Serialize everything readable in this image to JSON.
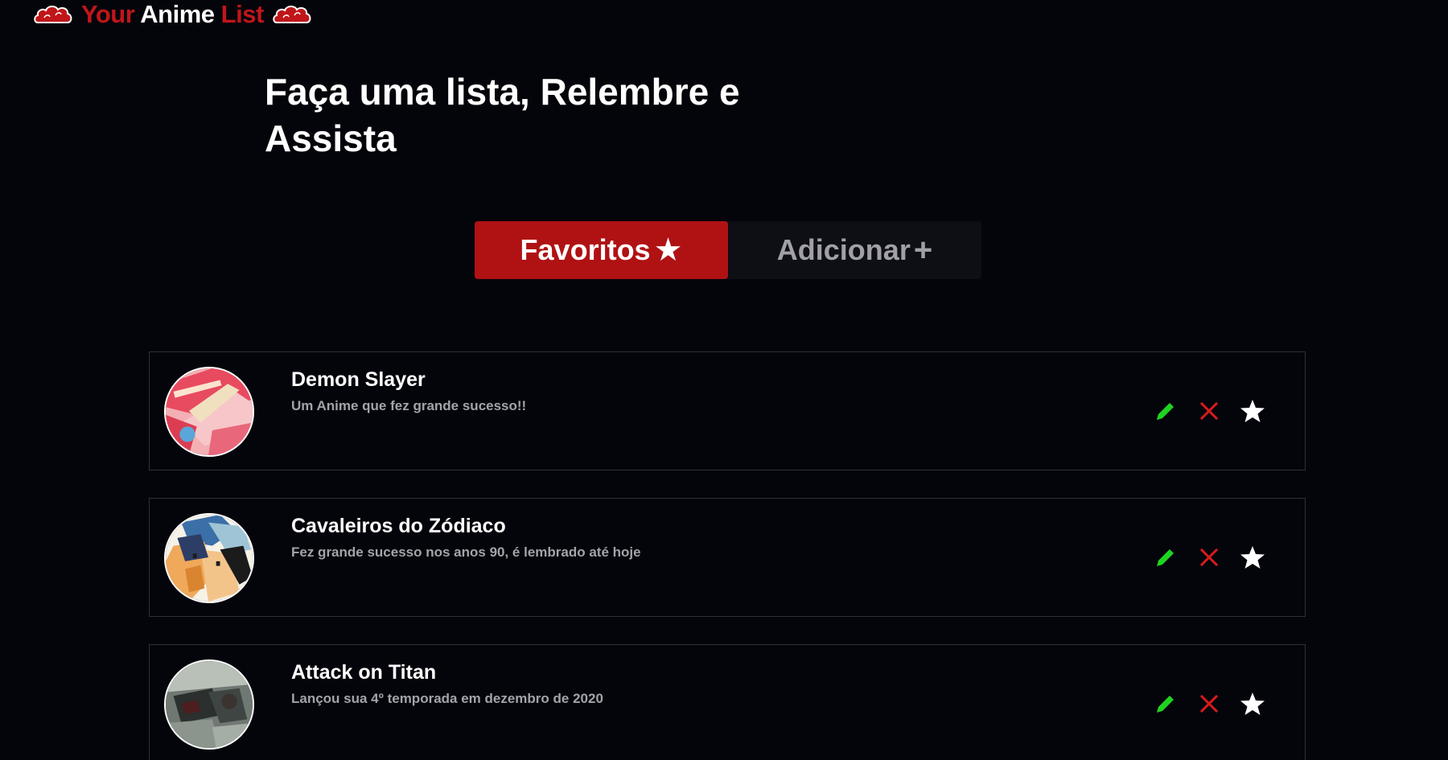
{
  "logo": {
    "part1": "Your",
    "part2": "Anime",
    "part3": "List",
    "icon": "akatsuki-cloud-icon",
    "accent": "#c0161a"
  },
  "hero": {
    "title": "Faça uma lista, Relembre e Assista"
  },
  "tabs": [
    {
      "label": "Favoritos",
      "glyph": "★",
      "active": true,
      "color": "#b01214"
    },
    {
      "label": "Adicionar",
      "glyph": "+",
      "active": false,
      "color": "#0e0e15"
    }
  ],
  "animes": [
    {
      "title": "Demon Slayer",
      "description": "Um Anime que fez grande sucesso!!",
      "image": "demon-slayer-cover"
    },
    {
      "title": "Cavaleiros do Zódiaco",
      "description": "Fez grande sucesso nos anos 90, é lembrado até hoje",
      "image": "cavaleiros-cover"
    },
    {
      "title": "Attack on Titan",
      "description": "Lançou sua 4º temporada em dezembro de 2020",
      "image": "attack-on-titan-cover"
    }
  ],
  "actions": {
    "edit_icon": "pencil-icon",
    "delete_icon": "close-icon",
    "favorite_icon": "star-icon",
    "edit_color": "#1fd41f",
    "delete_color": "#d81b1b",
    "favorite_color": "#ffffff"
  }
}
